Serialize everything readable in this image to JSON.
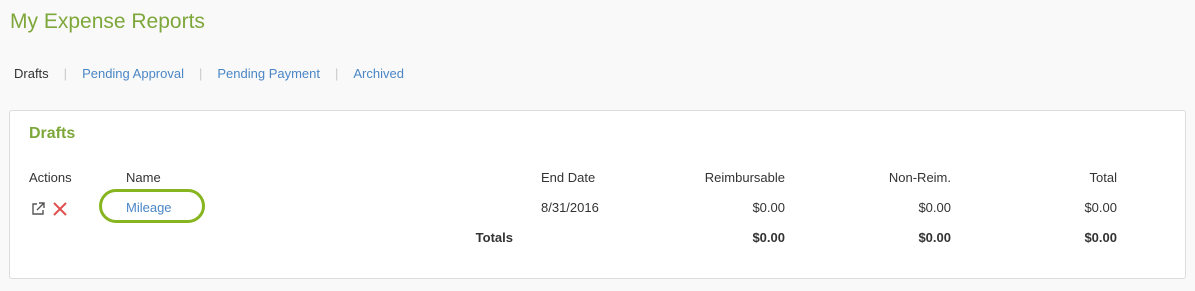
{
  "page": {
    "title": "My Expense Reports"
  },
  "tabs": [
    {
      "label": "Drafts",
      "active": true
    },
    {
      "label": "Pending Approval",
      "active": false
    },
    {
      "label": "Pending Payment",
      "active": false
    },
    {
      "label": "Archived",
      "active": false
    }
  ],
  "panel": {
    "title": "Drafts",
    "columns": {
      "actions": "Actions",
      "name": "Name",
      "end_date": "End Date",
      "reimbursable": "Reimbursable",
      "non_reim": "Non-Reim.",
      "total": "Total"
    },
    "rows": [
      {
        "name": "Mileage",
        "end_date": "8/31/2016",
        "reimbursable": "$0.00",
        "non_reim": "$0.00",
        "total": "$0.00",
        "actions": [
          "external-link-icon",
          "delete-x-icon"
        ]
      }
    ],
    "totals": {
      "label": "Totals",
      "reimbursable": "$0.00",
      "non_reim": "$0.00",
      "total": "$0.00"
    }
  },
  "colors": {
    "accent_green": "#7ea73b",
    "link_blue": "#4a86c5",
    "delete_red": "#e05050",
    "highlight_green": "#86b51f"
  }
}
